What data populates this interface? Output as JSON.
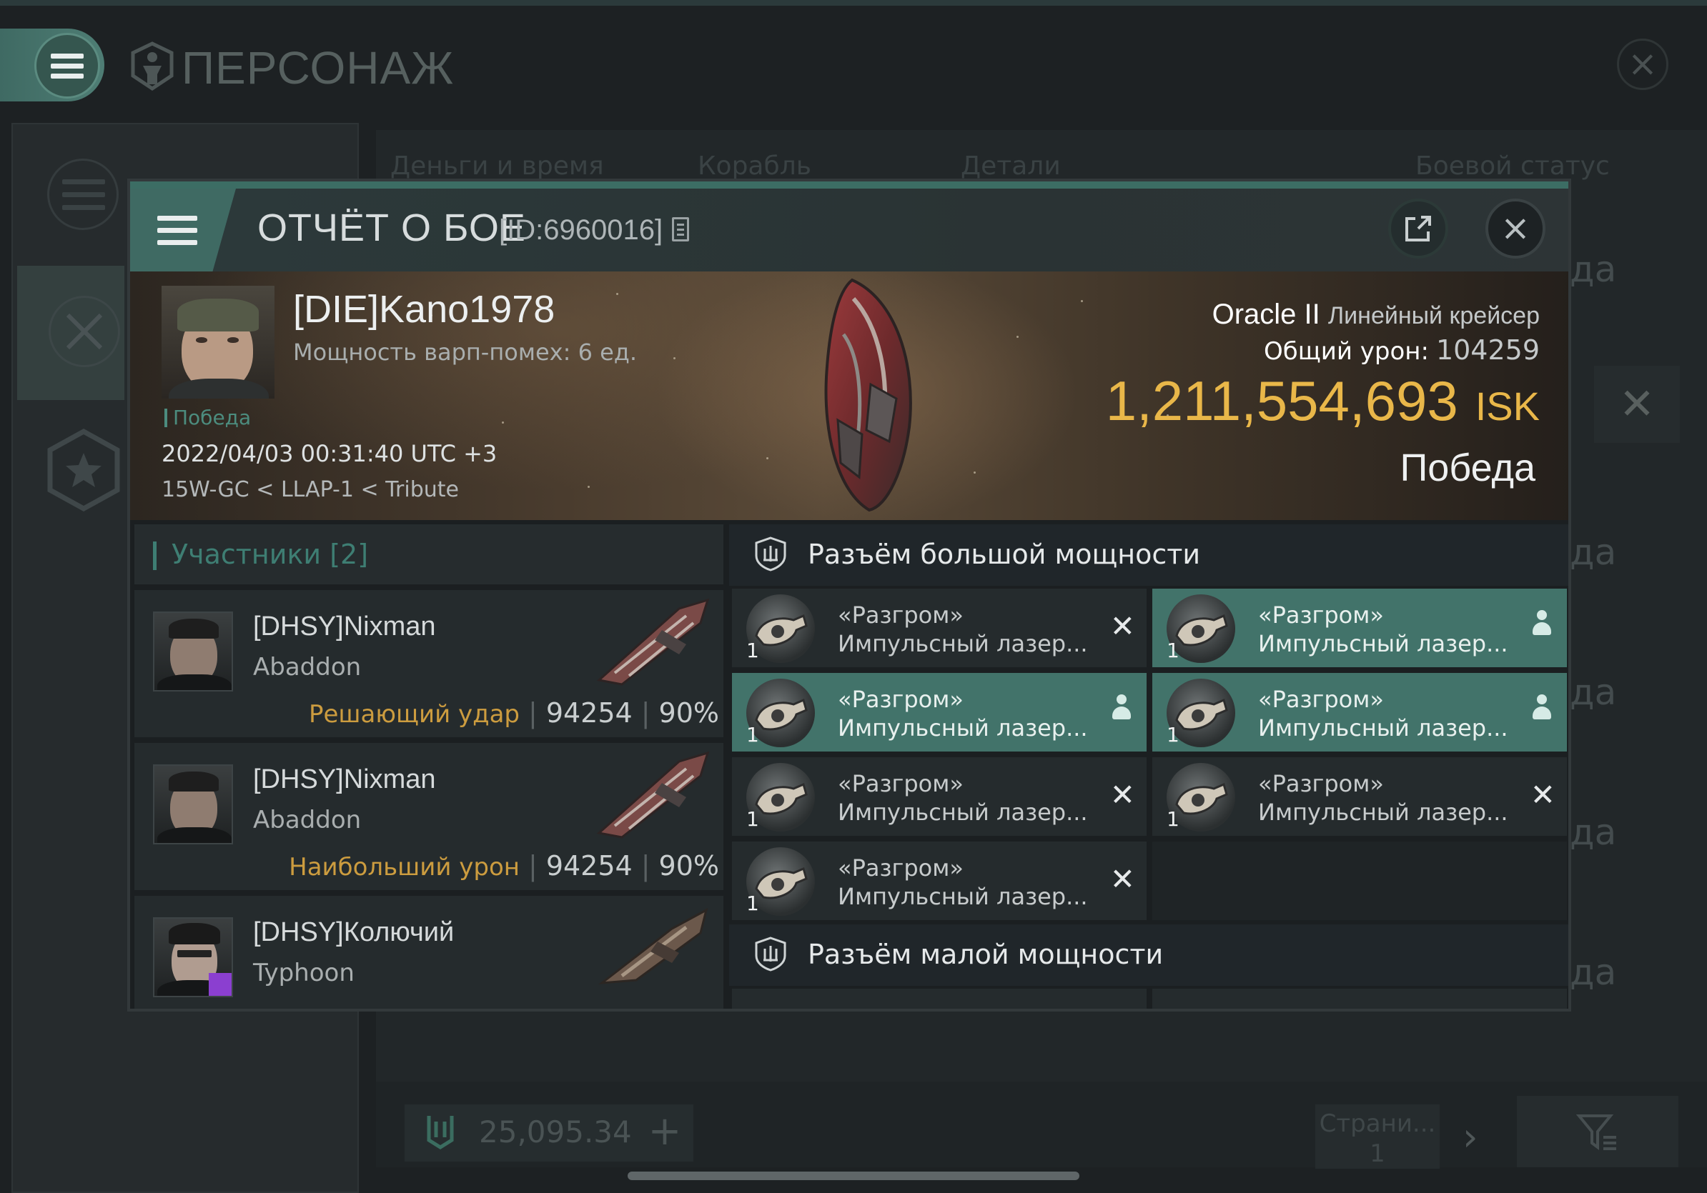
{
  "window": {
    "title": "ПЕРСОНАЖ",
    "columns": [
      "Деньги и время",
      "Корабль",
      "Детали",
      "Боевой статус"
    ],
    "row_status": [
      "да",
      "да",
      "да",
      "да",
      "да",
      "да"
    ],
    "wallet_value": "25,095.34",
    "page_label": "Страни...",
    "page_number": "1"
  },
  "report": {
    "title": "ОТЧЁТ О БОЕ",
    "id_label": "[ID:6960016]",
    "pilot": {
      "name": "[DIE]Kano1978",
      "warp_disrupt": "Мощность варп-помех: 6 ед.",
      "outcome_tag": "Победа",
      "datetime": "2022/04/03 00:31:40 UTC +3",
      "location": "15W-GC < LLAP-1 < Tribute"
    },
    "ship_name": "Oracle II",
    "ship_class": "Линейный крейсер",
    "total_damage_label": "Общий урон:",
    "total_damage_value": "104259",
    "isk_value": "1,211,554,693",
    "isk_currency": "ISK",
    "result": "Победа",
    "participants_label": "Участники",
    "participants_count": "[2]",
    "participants": [
      {
        "name": "[DHSY]Nixman",
        "ship": "Abaddon",
        "role": "Решающий удар",
        "damage": "94254",
        "percent": "90%"
      },
      {
        "name": "[DHSY]Nixman",
        "ship": "Abaddon",
        "role": "Наибольший урон",
        "damage": "94254",
        "percent": "90%"
      },
      {
        "name": "[DHSY]Колючий",
        "ship": "Typhoon",
        "role": "",
        "damage": "",
        "percent": ""
      }
    ],
    "high_slots_label": "Разъём большой мощности",
    "low_slots_label": "Разъём малой мощности",
    "modules": [
      {
        "qty": "1",
        "line1": "«Разгром»",
        "line2": "Импульсный лазер...",
        "state": "destroyed"
      },
      {
        "qty": "1",
        "line1": "«Разгром»",
        "line2": "Импульсный лазер...",
        "state": "dropped"
      },
      {
        "qty": "1",
        "line1": "«Разгром»",
        "line2": "Импульсный лазер...",
        "state": "dropped"
      },
      {
        "qty": "1",
        "line1": "«Разгром»",
        "line2": "Импульсный лазер...",
        "state": "dropped"
      },
      {
        "qty": "1",
        "line1": "«Разгром»",
        "line2": "Импульсный лазер...",
        "state": "destroyed"
      },
      {
        "qty": "1",
        "line1": "«Разгром»",
        "line2": "Импульсный лазер...",
        "state": "destroyed"
      },
      {
        "qty": "1",
        "line1": "«Разгром»",
        "line2": "Импульсный лазер...",
        "state": "destroyed"
      }
    ]
  },
  "colors": {
    "accent": "#3f6a63",
    "highlight_row": "#42736a",
    "isk_gold": "#e9b749",
    "role_gold": "#cc9c3f",
    "victory_teal": "#4c8c7e"
  },
  "icons": [
    "menu-icon",
    "character-icon",
    "close-icon",
    "share-icon",
    "copy-icon",
    "shield-slot-icon",
    "person-icon",
    "cross-icon",
    "tools-icon",
    "star-icon",
    "filter-icon",
    "plus-icon",
    "chevron-right-icon"
  ]
}
